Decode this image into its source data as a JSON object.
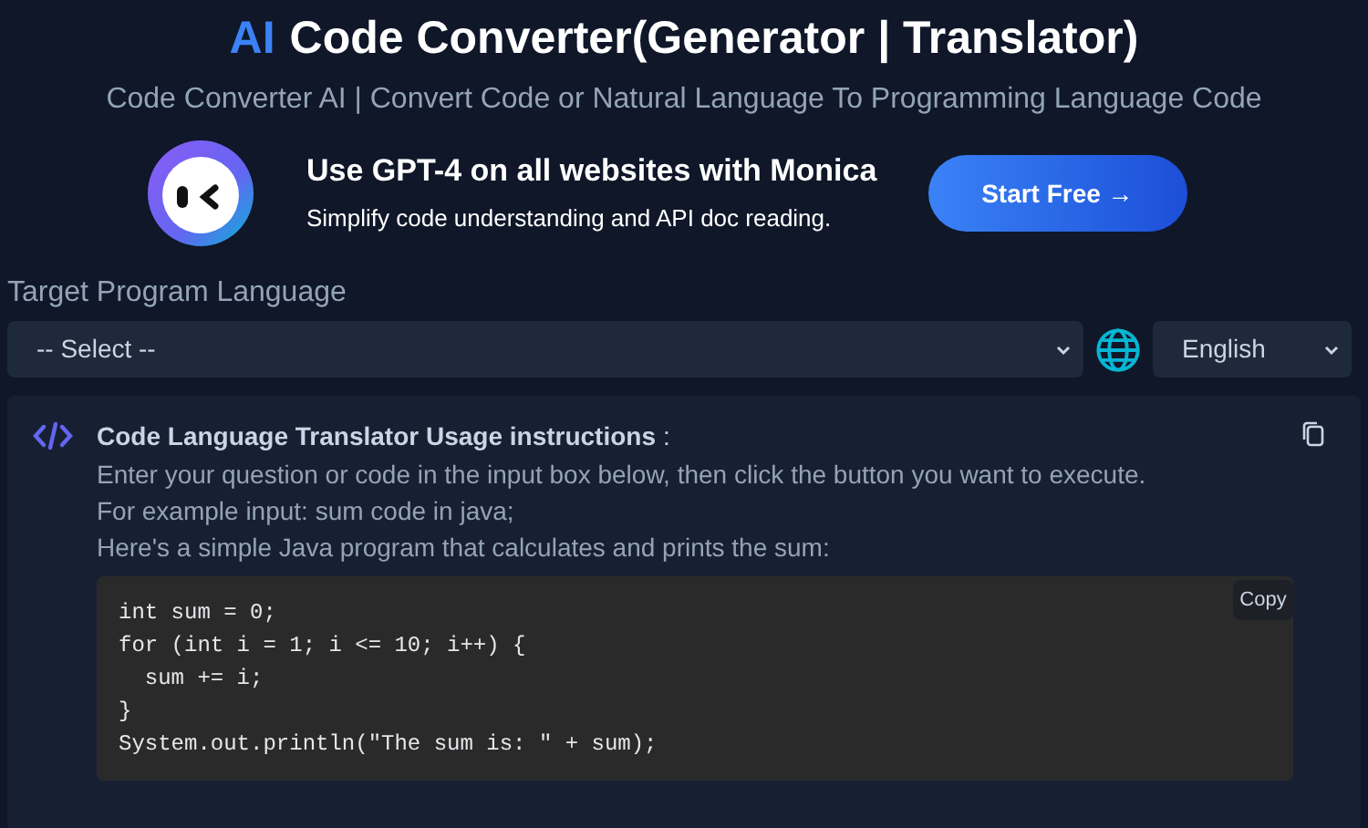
{
  "header": {
    "title_accent": "AI",
    "title": "Code Converter(Generator | Translator)",
    "subtitle": "Code Converter AI | Convert Code or Natural Language To Programming Language Code"
  },
  "banner": {
    "heading": "Use GPT-4 on all websites with Monica",
    "text": "Simplify code understanding and API doc reading.",
    "button": "Start Free →"
  },
  "target": {
    "label": "Target Program Language",
    "select_value": "-- Select --",
    "language_value": "English"
  },
  "instructions": {
    "title": "Code Language Translator Usage instructions",
    "colon": ":",
    "lines": [
      "Enter your question or code in the input box below, then click the button you want to execute.",
      "For example input: sum code in java;",
      "Here's a simple Java program that calculates and prints the sum:"
    ],
    "copy_button": "Copy",
    "code": [
      "int sum = 0;",
      "for (int i = 1; i <= 10; i++) {",
      "  sum += i;",
      "}",
      "System.out.println(\"The sum is: \" + sum);"
    ]
  }
}
